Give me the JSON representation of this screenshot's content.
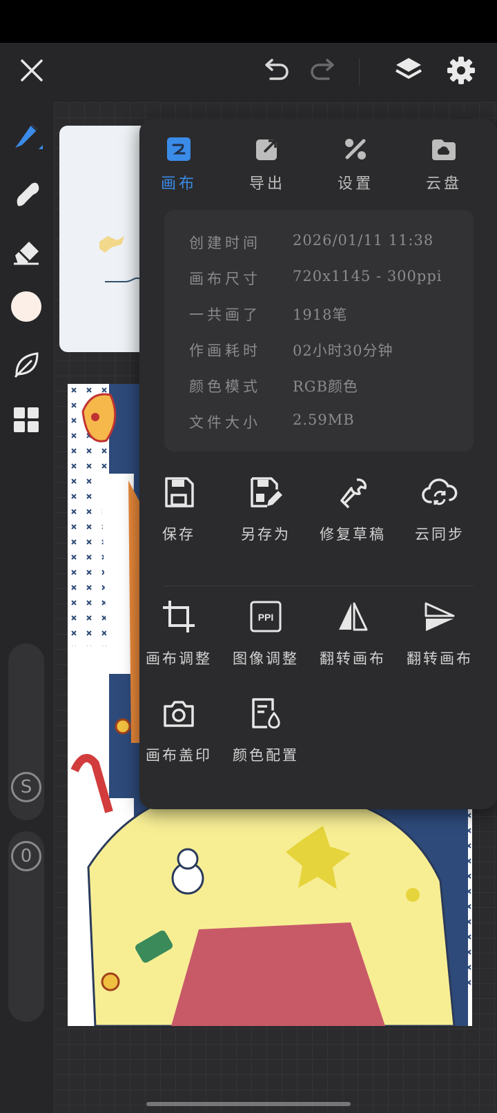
{
  "colors": {
    "accent": "#3b8be8",
    "panel": "#2b2b2d",
    "info_box": "#323235"
  },
  "toolbar": {
    "close": "close-icon",
    "undo": "undo-icon",
    "redo": "redo-icon",
    "layers": "layers-icon",
    "settings": "gear-icon"
  },
  "tools": [
    "pen-icon",
    "smudge-icon",
    "eraser-icon",
    "color-swatch",
    "leaf-icon",
    "grid-icon"
  ],
  "sliders": {
    "size_badge": "S",
    "opacity_badge": "0"
  },
  "panel": {
    "tabs": [
      {
        "label": "画布",
        "icon": "canvas-icon",
        "active": true
      },
      {
        "label": "导出",
        "icon": "export-icon",
        "active": false
      },
      {
        "label": "设置",
        "icon": "settings-tools-icon",
        "active": false
      },
      {
        "label": "云盘",
        "icon": "cloud-drive-icon",
        "active": false
      }
    ],
    "info": [
      {
        "key": "创建时间",
        "value": "2026/01/11 11:38"
      },
      {
        "key": "画布尺寸",
        "value": "720x1145 - 300ppi"
      },
      {
        "key": "一共画了",
        "value": "1918笔"
      },
      {
        "key": "作画耗时",
        "value": "02小时30分钟"
      },
      {
        "key": "颜色模式",
        "value": "RGB颜色"
      },
      {
        "key": "文件大小",
        "value": "2.59MB"
      }
    ],
    "actions_row1": [
      {
        "label": "保存",
        "icon": "save-icon"
      },
      {
        "label": "另存为",
        "icon": "save-as-icon"
      },
      {
        "label": "修复草稿",
        "icon": "wrench-icon"
      },
      {
        "label": "云同步",
        "icon": "cloud-sync-icon"
      }
    ],
    "actions_row2": [
      {
        "label": "画布调整",
        "icon": "crop-icon"
      },
      {
        "label": "图像调整",
        "icon": "ppi-icon"
      },
      {
        "label": "翻转画布",
        "icon": "flip-horizontal-icon"
      },
      {
        "label": "翻转画布",
        "icon": "flip-vertical-icon"
      }
    ],
    "actions_row3": [
      {
        "label": "画布盖印",
        "icon": "camera-icon"
      },
      {
        "label": "颜色配置",
        "icon": "color-profile-icon"
      }
    ],
    "ppi_text": "PPI"
  }
}
